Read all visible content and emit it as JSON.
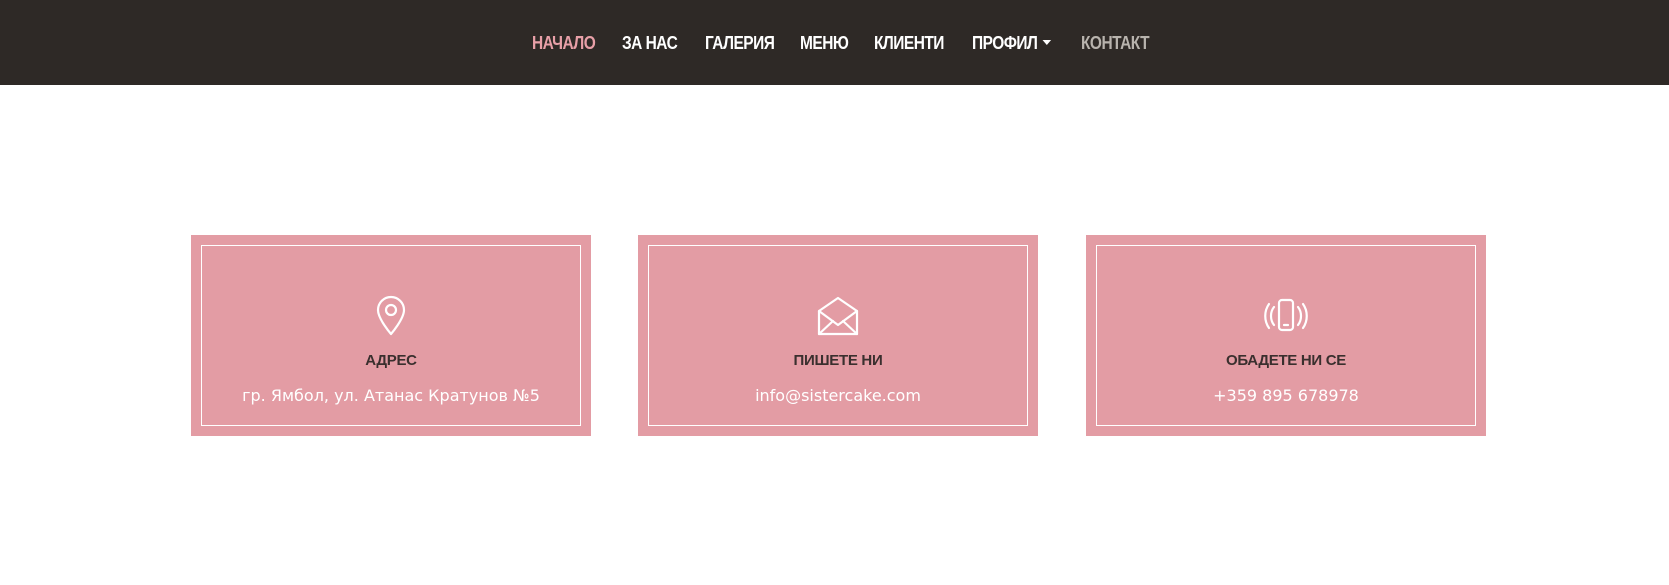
{
  "nav": {
    "items": [
      {
        "label": "НАЧАЛО"
      },
      {
        "label": "ЗА НАС"
      },
      {
        "label": "ГАЛЕРИЯ"
      },
      {
        "label": "МЕНЮ"
      },
      {
        "label": "КЛИЕНТИ"
      },
      {
        "label": "ПРОФИЛ"
      },
      {
        "label": "КОНТАКТ"
      }
    ],
    "active_color": "#e8a0a8",
    "muted_color": "#b8b3ad",
    "background": "#2e2926"
  },
  "cards": [
    {
      "icon": "map-pin-icon",
      "title": "АДРЕС",
      "text": "гр. Ямбол, ул. Атанас Кратунов №5"
    },
    {
      "icon": "envelope-icon",
      "title": "ПИШЕТЕ НИ",
      "text": "info@sistercake.com"
    },
    {
      "icon": "phone-vibrate-icon",
      "title": "ОБАДЕТЕ НИ СЕ",
      "text": "+359 895 678978"
    }
  ],
  "card_color": "#e39ca4"
}
